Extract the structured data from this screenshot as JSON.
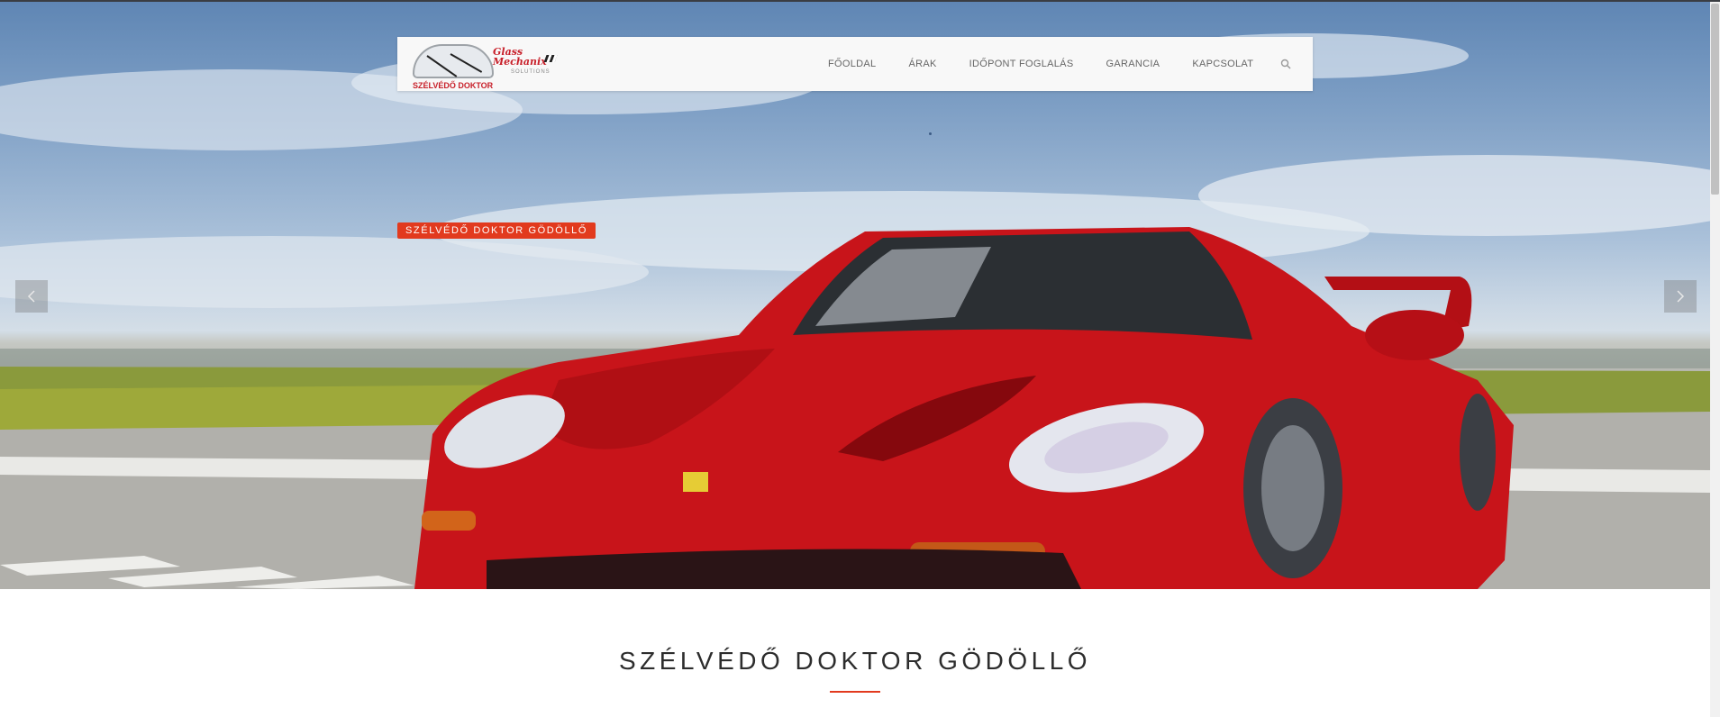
{
  "header": {
    "logo": {
      "brand": "Glass\nMechanix",
      "sub": "SOLUTIONS",
      "name": "SZÉLVÉDŐ DOKTOR"
    },
    "nav": [
      "FŐOLDAL",
      "ÁRAK",
      "IDŐPONT FOGLALÁS",
      "GARANCIA",
      "KAPCSOLAT"
    ],
    "search_icon": "search-icon"
  },
  "hero": {
    "badge": "SZÉLVÉDŐ DOKTOR GÖDÖLLŐ",
    "prev_icon": "chevron-left-icon",
    "next_icon": "chevron-right-icon",
    "image_subject": "red sports car on runway"
  },
  "section": {
    "title": "SZÉLVÉDŐ DOKTOR GÖDÖLLŐ"
  },
  "colors": {
    "accent": "#e23a1e",
    "nav_text": "#666666",
    "car_red": "#c8141a"
  }
}
